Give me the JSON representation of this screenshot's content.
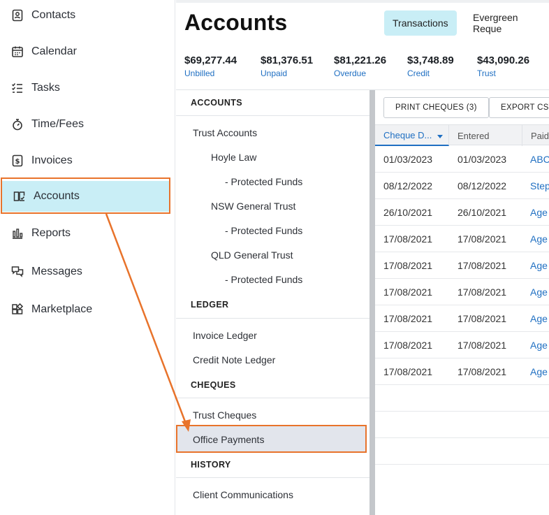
{
  "nav": {
    "items": [
      {
        "label": "Contacts",
        "icon": "contacts-icon"
      },
      {
        "label": "Calendar",
        "icon": "calendar-icon"
      },
      {
        "label": "Tasks",
        "icon": "tasks-icon"
      },
      {
        "label": "Time/Fees",
        "icon": "stopwatch-icon"
      },
      {
        "label": "Invoices",
        "icon": "invoice-icon"
      },
      {
        "label": "Accounts",
        "icon": "accounts-book-icon"
      },
      {
        "label": "Reports",
        "icon": "bar-chart-icon"
      },
      {
        "label": "Messages",
        "icon": "messages-icon"
      },
      {
        "label": "Marketplace",
        "icon": "marketplace-icon"
      }
    ],
    "active": "Accounts"
  },
  "header": {
    "title": "Accounts",
    "tabs": [
      {
        "label": "Transactions",
        "selected": true
      },
      {
        "label": "Evergreen Reque"
      }
    ]
  },
  "summary": [
    {
      "amount": "$69,277.44",
      "label": "Unbilled"
    },
    {
      "amount": "$81,376.51",
      "label": "Unpaid"
    },
    {
      "amount": "$81,221.26",
      "label": "Overdue"
    },
    {
      "amount": "$3,748.89",
      "label": "Credit"
    },
    {
      "amount": "$43,090.26",
      "label": "Trust"
    }
  ],
  "panel": {
    "accounts_head": "ACCOUNTS",
    "trust_accounts": "Trust Accounts",
    "hoyle_law": "Hoyle Law",
    "protected_1": "- Protected Funds",
    "nsw_general_trust": "NSW General Trust",
    "protected_2": "- Protected Funds",
    "qld_general_trust": "QLD General Trust",
    "protected_3": "- Protected Funds",
    "ledger_head": "LEDGER",
    "invoice_ledger": "Invoice Ledger",
    "credit_note_ledger": "Credit Note Ledger",
    "cheques_head": "CHEQUES",
    "trust_cheques": "Trust Cheques",
    "office_payments": "Office Payments",
    "history_head": "HISTORY",
    "client_communications": "Client Communications"
  },
  "toolbar": {
    "print_cheques": "PRINT CHEQUES (3)",
    "export_csv": "EXPORT CSV"
  },
  "table": {
    "columns": [
      "Cheque D...",
      "Entered",
      "Paid"
    ],
    "rows": [
      [
        "01/03/2023",
        "01/03/2023",
        "ABC"
      ],
      [
        "08/12/2022",
        "08/12/2022",
        "Step"
      ],
      [
        "26/10/2021",
        "26/10/2021",
        "Age"
      ],
      [
        "17/08/2021",
        "17/08/2021",
        "Age"
      ],
      [
        "17/08/2021",
        "17/08/2021",
        "Age"
      ],
      [
        "17/08/2021",
        "17/08/2021",
        "Age"
      ],
      [
        "17/08/2021",
        "17/08/2021",
        "Age"
      ],
      [
        "17/08/2021",
        "17/08/2021",
        "Age"
      ],
      [
        "17/08/2021",
        "17/08/2021",
        "Age"
      ]
    ]
  },
  "colors": {
    "accent": "#c9eef6",
    "link": "#1f6fc2",
    "annotation": "#e8732b"
  }
}
